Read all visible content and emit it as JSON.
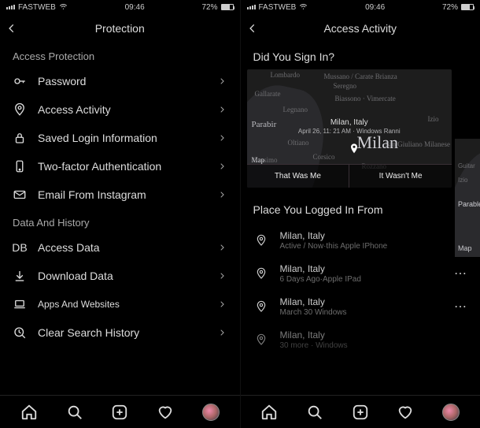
{
  "status": {
    "carrier": "FASTWEB",
    "time": "09:46",
    "battery": "72%"
  },
  "left": {
    "title": "Protection",
    "sections": {
      "protection": {
        "heading": "Access Protection",
        "password": "Password",
        "activity": "Access Activity",
        "saved": "Saved Login Information",
        "twofa": "Two-factor Authentication",
        "email": "Email From Instagram"
      },
      "data": {
        "heading": "Data And History",
        "access": "Access Data",
        "download": "Download Data",
        "apps": "Apps And Websites",
        "clear": "Clear Search History"
      }
    }
  },
  "right": {
    "title": "Access Activity",
    "prompt": "Did You Sign In?",
    "card": {
      "location_small": "Milan, Italy",
      "subtitle": "April 26, 11: 21 AM · Windows Ranni",
      "that_was": "That Was Me",
      "wasnt": "It Wasn't Me",
      "big_label": "Milan",
      "map_credit": "Map",
      "cities": {
        "lombardo": "Lombardo",
        "mussano": "Mussano / Carate Brianza",
        "seregno": "Seregno",
        "gallarate": "Gallarate",
        "biassono": "Biassono · Vimercate",
        "legnano": "Legnano",
        "izio": "Izio",
        "parabir": "Parabir",
        "oltiano": "Oltiano",
        "san_giuliano": "San Giuliano Milanese",
        "corsico": "Corsico",
        "cassimo": "Cassimo",
        "rozzano": "Rozzano"
      }
    },
    "peek": {
      "guitar": "Guitar",
      "parable": "Parable",
      "izio": "Izio",
      "credit": "Map"
    },
    "places": {
      "heading": "Place You Logged In From",
      "items": [
        {
          "loc": "Milan, Italy",
          "sub": "Active / Now·this Apple IPhone"
        },
        {
          "loc": "Milan, Italy",
          "sub": "6 Days Ago·Apple IPad"
        },
        {
          "loc": "Milan, Italy",
          "sub": "March 30 Windows"
        },
        {
          "loc": "Milan, Italy",
          "sub": "30 more · Windows"
        }
      ]
    }
  }
}
